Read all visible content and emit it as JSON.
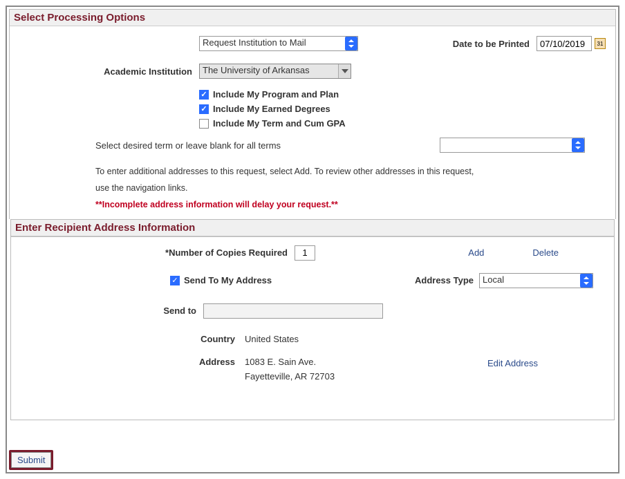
{
  "processing": {
    "header": "Select Processing Options",
    "deliveryMethod": "Request Institution to Mail",
    "datePrintedLabel": "Date to be Printed",
    "datePrinted": "07/10/2019",
    "academicInstLabel": "Academic Institution",
    "academicInst": "The University of Arkansas",
    "includeProgram": "Include My Program and Plan",
    "includeDegrees": "Include My Earned Degrees",
    "includeGPA": "Include My Term and Cum GPA",
    "termLabel": "Select desired term or leave blank for all terms",
    "termValue": "",
    "help": "To enter additional addresses to this request, select Add. To review other addresses in this request, use the navigation links.",
    "warning": "**Incomplete address information will delay your request.**"
  },
  "recipient": {
    "header": "Enter Recipient Address Information",
    "copiesLabel": "*Number of Copies Required",
    "copies": "1",
    "addLink": "Add",
    "deleteLink": "Delete",
    "sendToMyAddr": "Send To My Address",
    "addressTypeLabel": "Address Type",
    "addressType": "Local",
    "sendToLabel": "Send to",
    "sendToValue": "",
    "countryLabel": "Country",
    "country": "United States",
    "addressLabel": "Address",
    "addressLine1": "1083 E. Sain Ave.",
    "addressLine2": "Fayetteville, AR 72703",
    "editAddress": "Edit Address"
  },
  "submitLabel": "Submit"
}
